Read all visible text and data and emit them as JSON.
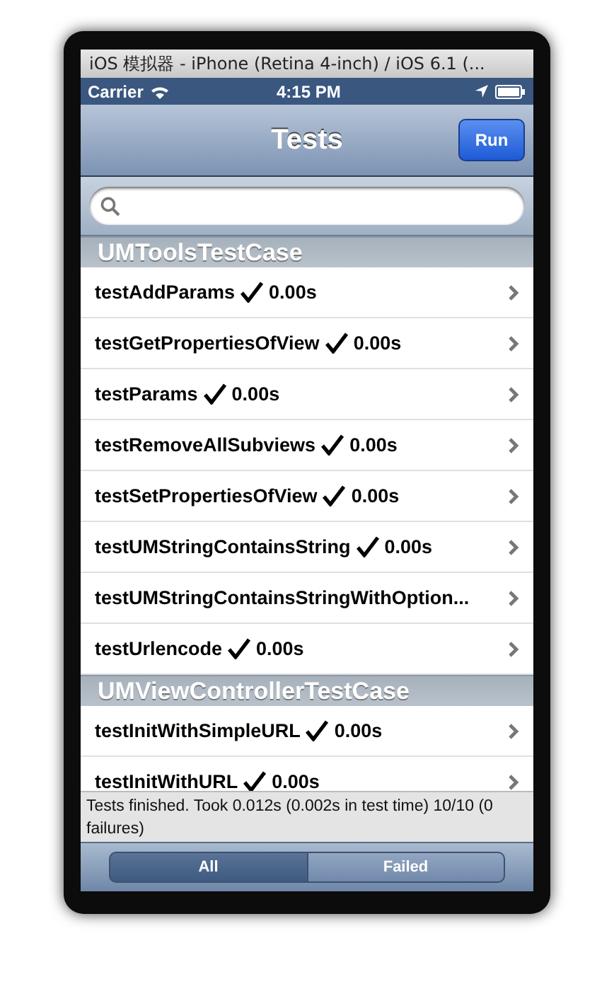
{
  "window": {
    "title": "iOS 模拟器 - iPhone (Retina 4-inch) / iOS 6.1 (..."
  },
  "status_bar": {
    "carrier": "Carrier",
    "time": "4:15 PM"
  },
  "nav_bar": {
    "title": "Tests",
    "button": "Run"
  },
  "sections": [
    {
      "title": "UMToolsTestCase",
      "rows": [
        {
          "name": "testAddParams",
          "passed": true,
          "time": "0.00s"
        },
        {
          "name": "testGetPropertiesOfView",
          "passed": true,
          "time": "0.00s"
        },
        {
          "name": "testParams",
          "passed": true,
          "time": "0.00s"
        },
        {
          "name": "testRemoveAllSubviews",
          "passed": true,
          "time": "0.00s"
        },
        {
          "name": "testSetPropertiesOfView",
          "passed": true,
          "time": "0.00s"
        },
        {
          "name": "testUMStringContainsString",
          "passed": true,
          "time": "0.00s"
        },
        {
          "name": "testUMStringContainsStringWithOption...",
          "passed": null,
          "time": null
        },
        {
          "name": "testUrlencode",
          "passed": true,
          "time": "0.00s"
        }
      ]
    },
    {
      "title": "UMViewControllerTestCase",
      "rows": [
        {
          "name": "testInitWithSimpleURL",
          "passed": true,
          "time": "0.00s"
        },
        {
          "name": "testInitWithURL",
          "passed": true,
          "time": "0.00s"
        }
      ]
    }
  ],
  "summary": "Tests finished. Took 0.012s (0.002s in test time) 10/10 (0 failures)",
  "segments": [
    {
      "label": "All",
      "selected": true
    },
    {
      "label": "Failed",
      "selected": false
    }
  ]
}
